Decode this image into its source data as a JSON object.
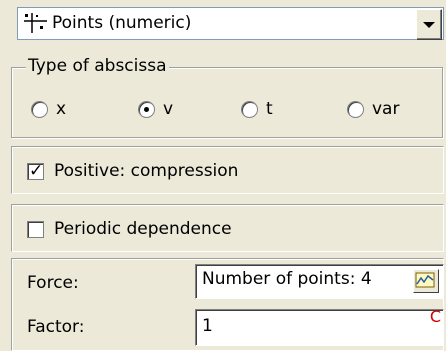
{
  "combo": {
    "value": "Points (numeric)",
    "icon": "points-icon"
  },
  "abscissa": {
    "title": "Type of abscissa",
    "options": [
      "x",
      "v",
      "t",
      "var"
    ],
    "selected": "v"
  },
  "positive": {
    "label": "Positive: compression",
    "checked": true
  },
  "periodic": {
    "label": "Periodic dependence",
    "checked": false
  },
  "force": {
    "label": "Force:",
    "value": "Number of points: 4"
  },
  "factor": {
    "label": "Factor:",
    "value": "1",
    "marker": "C"
  },
  "colors": {
    "background": "#ece9d8",
    "marker": "#d40000"
  }
}
